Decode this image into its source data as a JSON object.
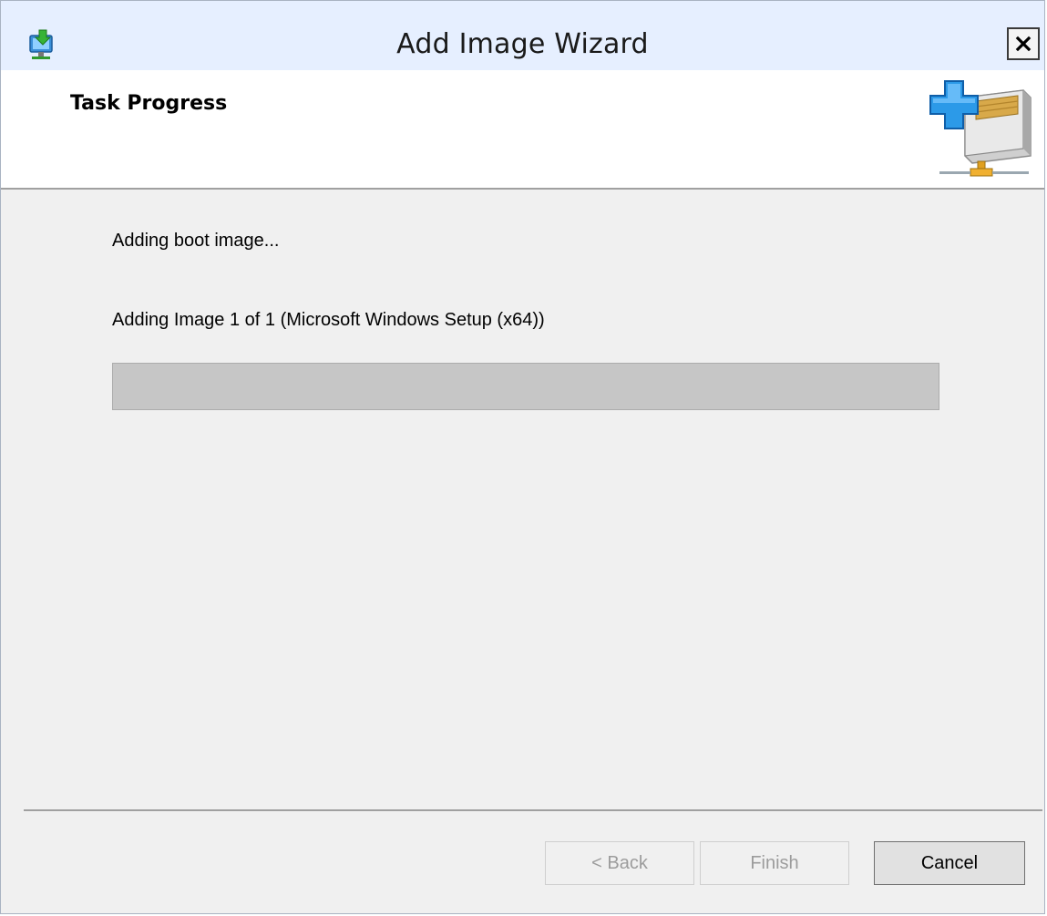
{
  "window": {
    "title": "Add Image Wizard",
    "app_icon": "wds-server-icon",
    "close_icon": "close-icon"
  },
  "header": {
    "page_title": "Task Progress",
    "icon": "add-image-store-icon"
  },
  "content": {
    "status_text": "Adding boot image...",
    "detail_text": "Adding Image 1 of 1 (Microsoft Windows Setup (x64))",
    "progress_percent": 0
  },
  "buttons": {
    "back_label": "< Back",
    "finish_label": "Finish",
    "cancel_label": "Cancel"
  },
  "colors": {
    "titlebar": "#e6efff",
    "background": "#f0f0f0",
    "progress_track": "#c6c6c6",
    "disabled_text": "#9c9c9c"
  }
}
